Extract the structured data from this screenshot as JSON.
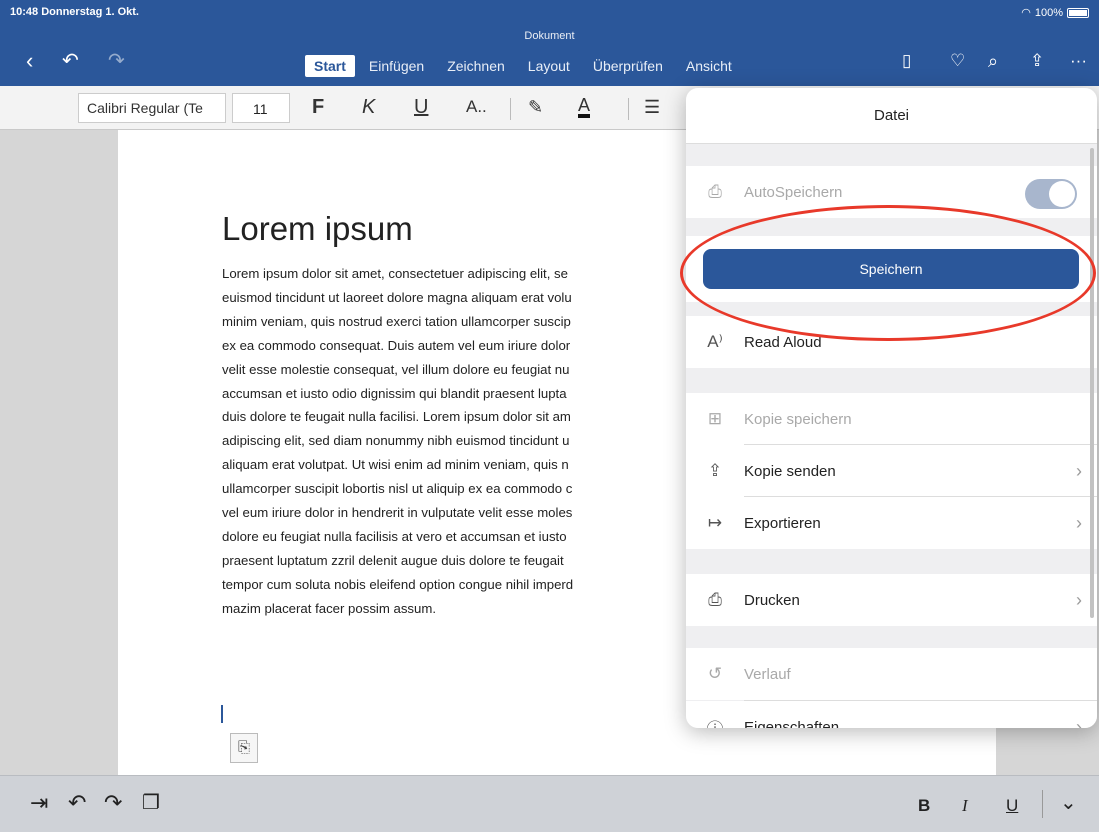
{
  "status": {
    "time": "10:48  Donnerstag 1. Okt.",
    "right": "100%"
  },
  "header": {
    "document_name": "Dokument",
    "tabs": [
      "Start",
      "Einfügen",
      "Zeichnen",
      "Layout",
      "Überprüfen",
      "Ansicht"
    ],
    "active_tab": "Start",
    "more_glyph": "···"
  },
  "ribbon": {
    "font_name": "Calibri Regular (Te",
    "font_size": "11",
    "bold_glyph": "F",
    "italic_glyph": "K",
    "underline_glyph": "U"
  },
  "document": {
    "heading": "Lorem ipsum",
    "lines": [
      "Lorem ipsum dolor sit amet, consectetuer adipiscing elit, se",
      "euismod tincidunt ut laoreet dolore magna aliquam erat volu",
      "minim veniam, quis nostrud exerci tation ullamcorper suscip",
      "ex ea commodo consequat. Duis autem vel eum iriure dolor",
      "velit esse molestie consequat, vel illum dolore eu feugiat nu",
      "accumsan et iusto odio dignissim qui blandit praesent lupta",
      "duis dolore te feugait nulla facilisi. Lorem ipsum dolor sit am",
      "adipiscing elit, sed diam nonummy nibh euismod tincidunt u",
      "aliquam erat volutpat. Ut wisi enim ad minim veniam, quis n",
      "ullamcorper suscipit lobortis nisl ut aliquip ex ea commodo c",
      "vel eum iriure dolor in hendrerit in vulputate velit esse moles",
      "dolore eu feugiat nulla facilisis at vero et accumsan et iusto",
      "praesent luptatum zzril delenit augue duis dolore te feugait",
      "tempor cum soluta nobis eleifend option congue nihil imperd",
      "mazim placerat facer possim assum."
    ]
  },
  "panel": {
    "title": "Datei",
    "autosave_label": "AutoSpeichern",
    "save_label": "Speichern",
    "read_aloud_label": "Read Aloud",
    "save_copy_label": "Kopie speichern",
    "send_copy_label": "Kopie senden",
    "export_label": "Exportieren",
    "print_label": "Drucken",
    "history_label": "Verlauf",
    "properties_label": "Eigenschaften"
  },
  "bottom": {
    "bold": "B",
    "italic": "I",
    "underline": "U"
  },
  "colors": {
    "accent": "#2b579a",
    "annotation": "#e8392a"
  }
}
